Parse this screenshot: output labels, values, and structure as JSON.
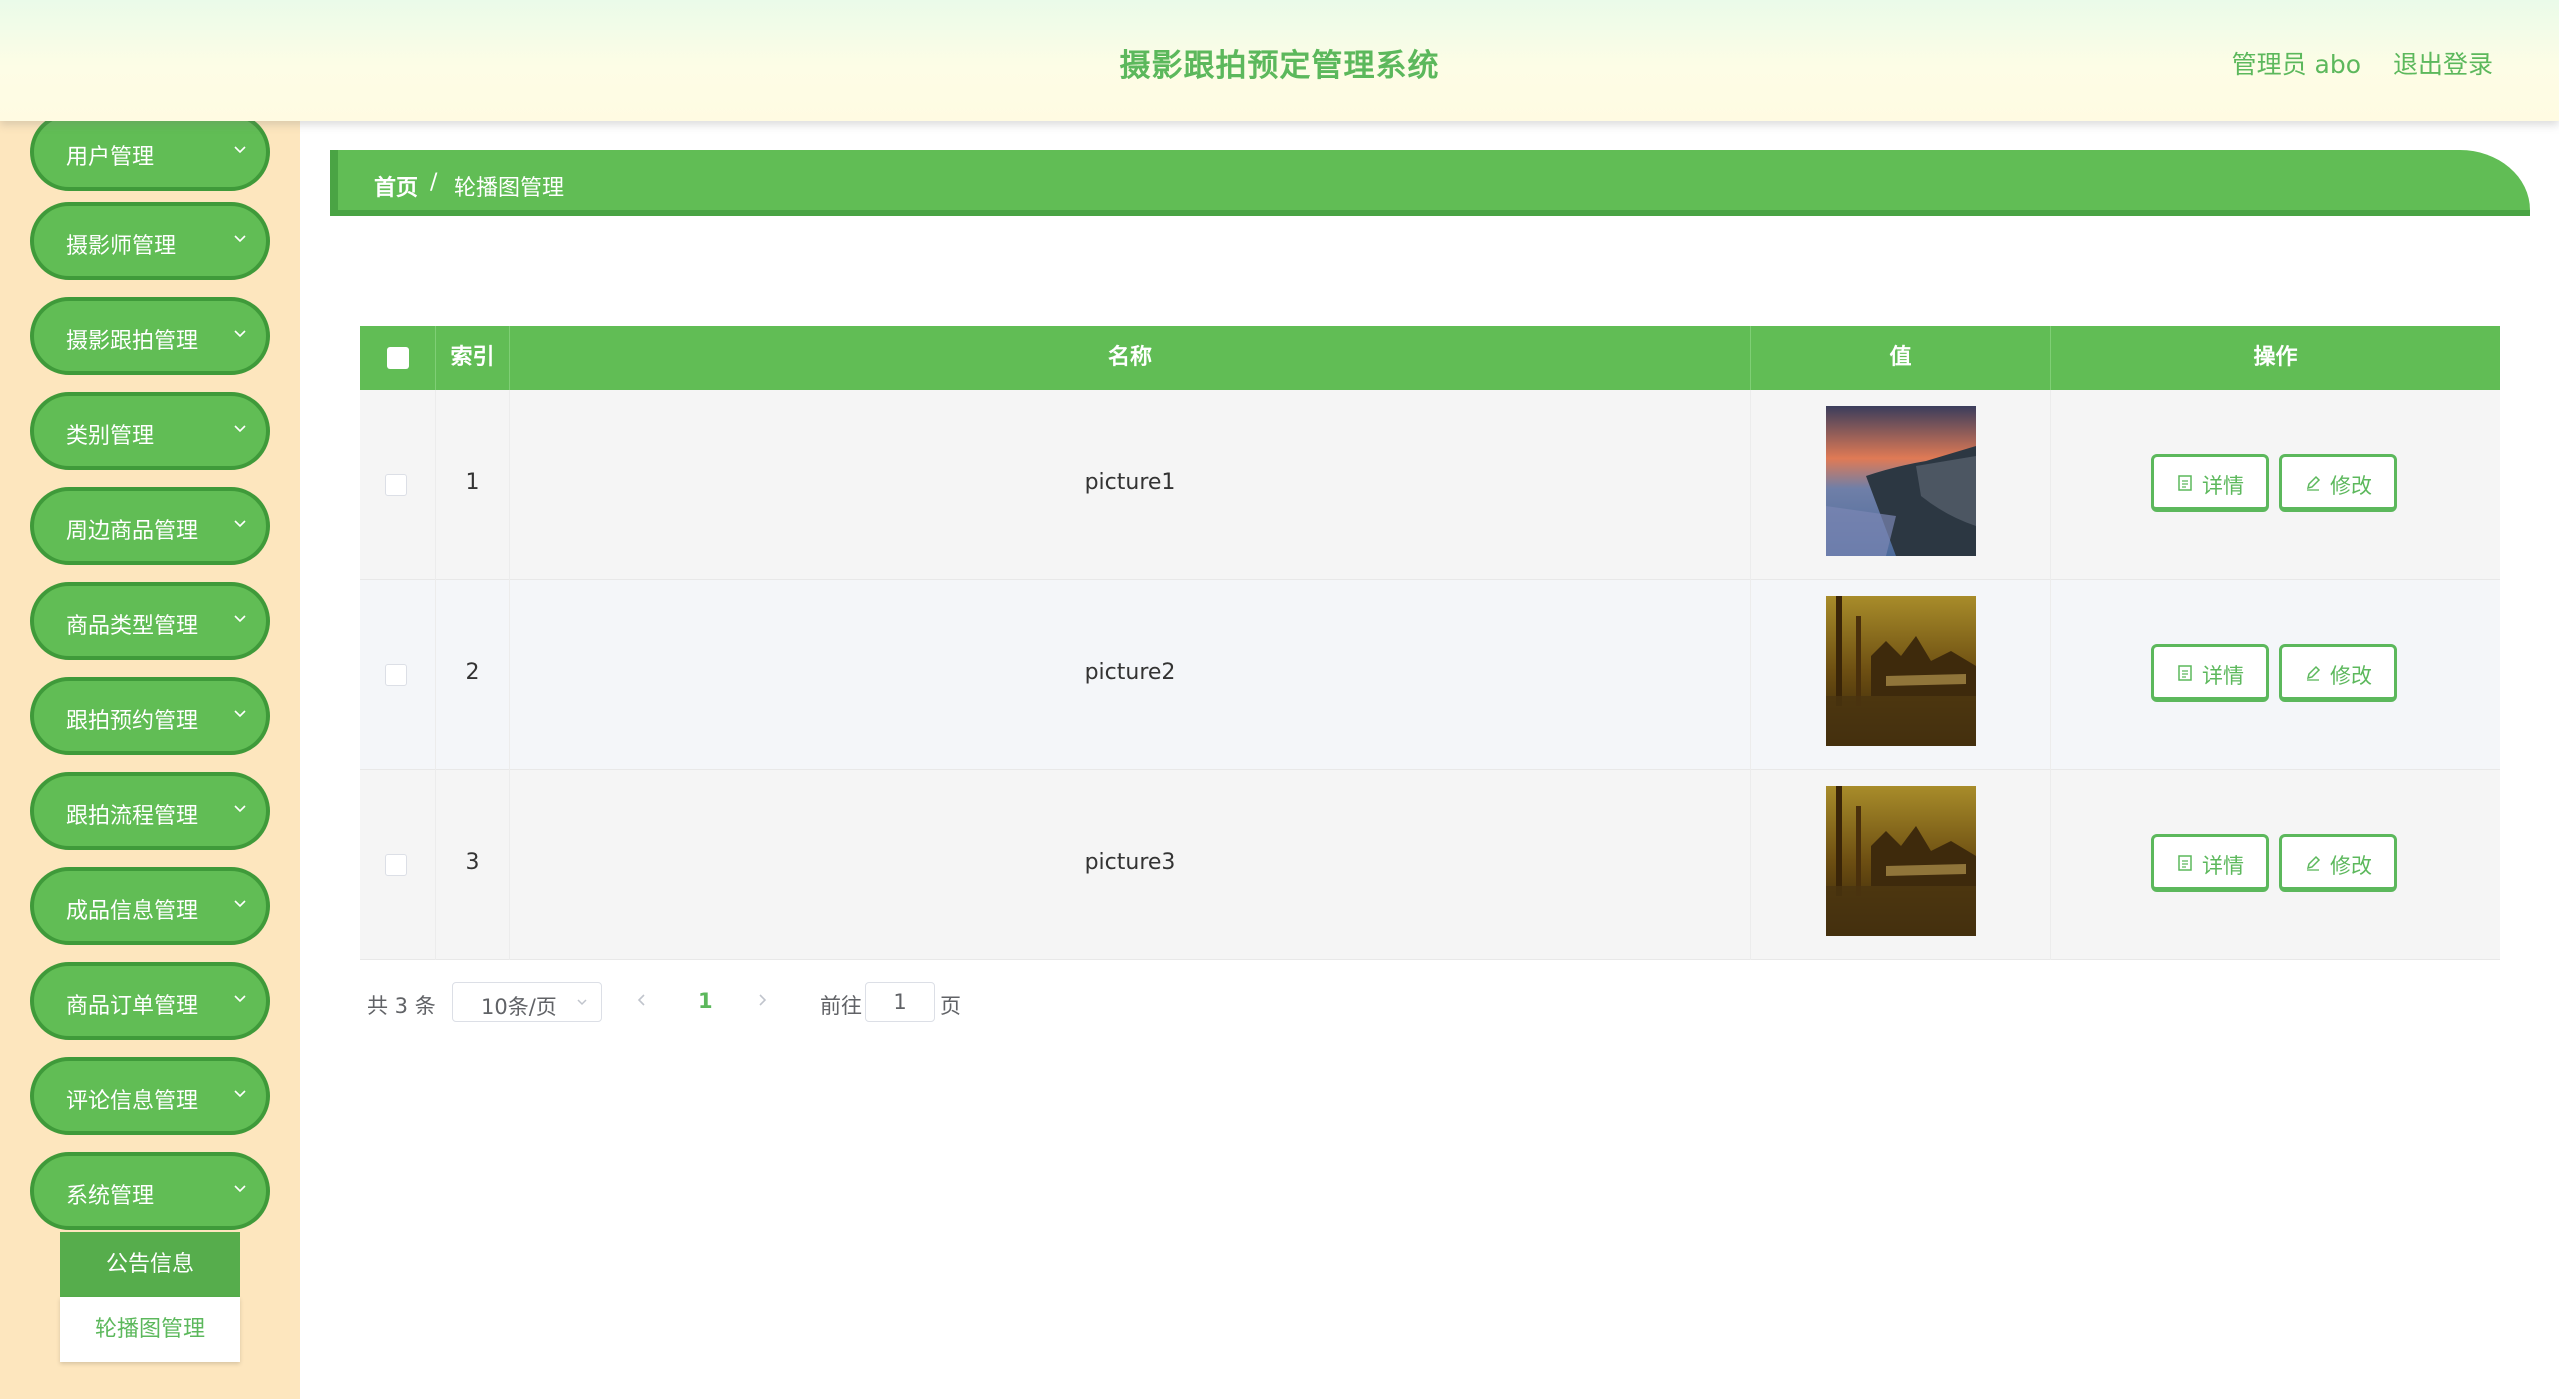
{
  "header": {
    "title": "摄影跟拍预定管理系统",
    "user": "管理员 abo",
    "logout": "退出登录"
  },
  "sidebar": {
    "items": [
      {
        "label": "用户管理"
      },
      {
        "label": "摄影师管理"
      },
      {
        "label": "摄影跟拍管理"
      },
      {
        "label": "类别管理"
      },
      {
        "label": "周边商品管理"
      },
      {
        "label": "商品类型管理"
      },
      {
        "label": "跟拍预约管理"
      },
      {
        "label": "跟拍流程管理"
      },
      {
        "label": "成品信息管理"
      },
      {
        "label": "商品订单管理"
      },
      {
        "label": "评论信息管理"
      },
      {
        "label": "系统管理"
      }
    ],
    "submenu": [
      {
        "label": "公告信息"
      },
      {
        "label": "轮播图管理"
      }
    ]
  },
  "breadcrumb": {
    "home": "首页",
    "separator": "/",
    "current": "轮播图管理"
  },
  "table": {
    "columns": {
      "index": "索引",
      "name": "名称",
      "value": "值",
      "action": "操作"
    },
    "rows": [
      {
        "index": "1",
        "name": "picture1",
        "image": "sunset-lake-thumbnail"
      },
      {
        "index": "2",
        "name": "picture2",
        "image": "golden-pier-thumbnail"
      },
      {
        "index": "3",
        "name": "picture3",
        "image": "golden-pier-thumbnail"
      }
    ],
    "buttons": {
      "detail": "详情",
      "edit": "修改"
    }
  },
  "pagination": {
    "total": "共 3 条",
    "page_size": "10条/页",
    "current_page": "1",
    "goto_label": "前往",
    "goto_value": "1",
    "page_unit": "页"
  },
  "colors": {
    "primary_green": "#61bd55",
    "dark_green": "#3f9a3a",
    "sidebar_bg": "#fde6be",
    "text_green": "#5cb85c"
  }
}
